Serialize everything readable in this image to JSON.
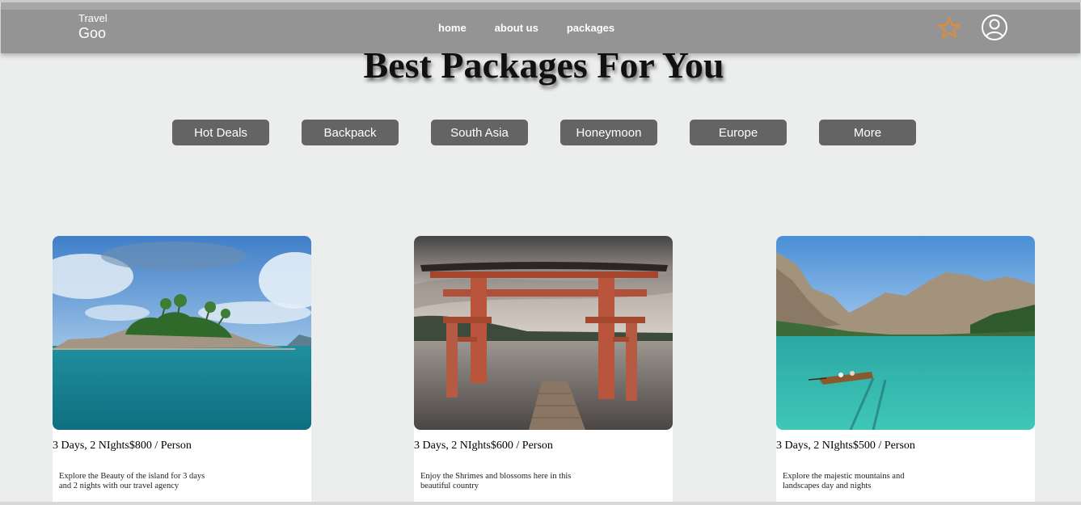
{
  "brand": {
    "line1": "Travel",
    "line2": "Goo"
  },
  "nav": {
    "home": "home",
    "about": "about us",
    "packages": "packages"
  },
  "icons": {
    "favorites": "star-icon",
    "account": "user-icon"
  },
  "colors": {
    "navbar": "#949494",
    "background": "#eceeed",
    "filter_button": "#646464",
    "star": "#e88a2e"
  },
  "heading": "Best Packages For You",
  "filters": [
    "Hot Deals",
    "Backpack",
    "South Asia",
    "Honeymoon",
    "Europe",
    "More"
  ],
  "cards": [
    {
      "image": "tropical island photo",
      "duration": "3 Days, 2 NIghts",
      "price": "$800",
      "per": " / Person",
      "desc_line1": "Explore the Beauty of the island for 3 days",
      "desc_line2": "and 2 nights with our travel agency"
    },
    {
      "image": "torii gate over lake photo",
      "duration": "3 Days, 2 NIghts",
      "price": "$600",
      "per": " / Person",
      "desc_line1": "Enjoy the Shrimes and blossoms here in this",
      "desc_line2": "beautiful country"
    },
    {
      "image": "mountain lake with boat photo",
      "duration": "3 Days, 2 NIghts",
      "price": "$500",
      "per": " / Person",
      "desc_line1": "Explore the majestic mountains and",
      "desc_line2": "landscapes day and nights"
    }
  ]
}
